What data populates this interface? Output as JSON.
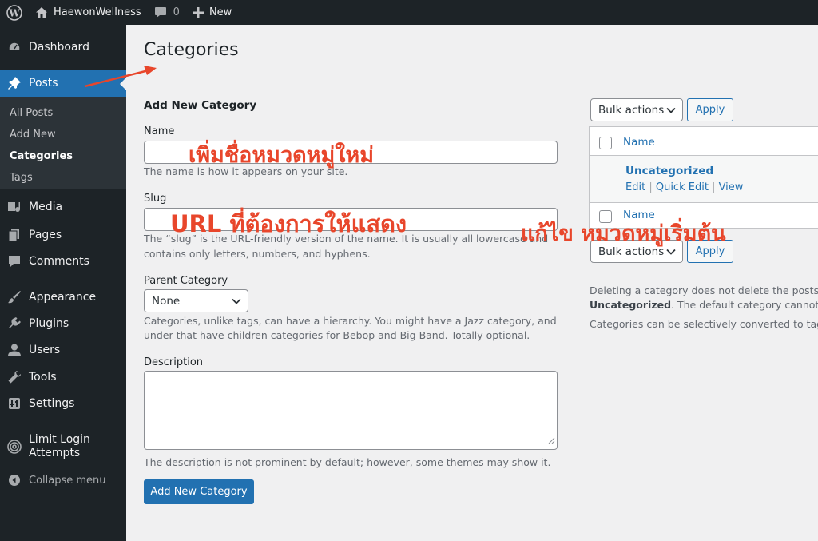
{
  "adminbar": {
    "site_name": "HaewonWellness",
    "comments_count": "0",
    "new_label": "New"
  },
  "sidebar": {
    "items": [
      {
        "label": "Dashboard",
        "icon": "dashboard-icon"
      },
      {
        "label": "Posts",
        "icon": "pushpin-icon"
      },
      {
        "label": "Media",
        "icon": "media-icon"
      },
      {
        "label": "Pages",
        "icon": "pages-icon"
      },
      {
        "label": "Comments",
        "icon": "comment-bubble-icon"
      },
      {
        "label": "Appearance",
        "icon": "paintbrush-icon"
      },
      {
        "label": "Plugins",
        "icon": "plugin-icon"
      },
      {
        "label": "Users",
        "icon": "user-icon"
      },
      {
        "label": "Tools",
        "icon": "wrench-icon"
      },
      {
        "label": "Settings",
        "icon": "settings-icon"
      },
      {
        "label": "Limit Login",
        "label2": "Attempts",
        "icon": "fingerprint-icon"
      }
    ],
    "submenu": [
      "All Posts",
      "Add New",
      "Categories",
      "Tags"
    ],
    "collapse_label": "Collapse menu"
  },
  "main": {
    "title": "Categories",
    "section_title": "Add New Category",
    "name_label": "Name",
    "name_help": "The name is how it appears on your site.",
    "slug_label": "Slug",
    "slug_help_1": "The “slug” is the URL-friendly version of the name. It is usually all lowercase and",
    "slug_help_2": "contains only letters, numbers, and hyphens.",
    "parent_label": "Parent Category",
    "parent_value": "None",
    "parent_help_1": "Categories, unlike tags, can have a hierarchy. You might have a Jazz category, and",
    "parent_help_2": "under that have children categories for Bebop and Big Band. Totally optional.",
    "description_label": "Description",
    "description_help": "The description is not prominent by default; however, some themes may show it.",
    "submit_label": "Add New Category"
  },
  "list": {
    "bulk_actions": "Bulk actions",
    "apply": "Apply",
    "column_name": "Name",
    "row_name": "Uncategorized",
    "row_actions": [
      "Edit",
      "Quick Edit",
      "View"
    ],
    "note_1": "Deleting a category does not delete the posts",
    "note_2_bold": "Uncategorized",
    "note_2_rest": ". The default category cannot b",
    "note_3": "Categories can be selectively converted to tag"
  },
  "annotations": {
    "name": "เพิ่มชื่อหมวดหมู่ใหม่",
    "slug": "URL ที่ต้องการให้แสดง",
    "default": "แก้ไข หมวดหมู่เริ่มต้น",
    "color": "#e8462b"
  }
}
